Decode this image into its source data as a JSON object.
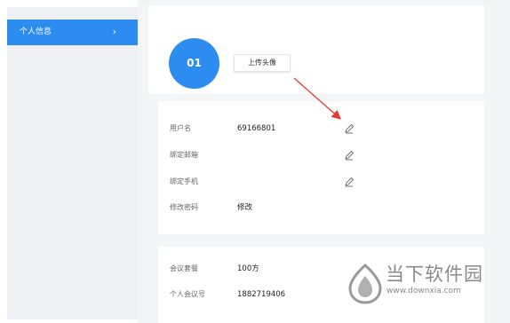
{
  "sidebar": {
    "items": [
      {
        "label": "个人信息"
      }
    ]
  },
  "profile": {
    "avatar_text": "01",
    "upload_label": "上传头像"
  },
  "account": {
    "rows": [
      {
        "label": "用户名",
        "value": "69166801",
        "editable": true
      },
      {
        "label": "绑定邮箱",
        "value": "",
        "editable": true
      },
      {
        "label": "绑定手机",
        "value": "",
        "editable": true
      },
      {
        "label": "修改密码",
        "value": "修改",
        "editable": false
      }
    ]
  },
  "meeting": {
    "rows": [
      {
        "label": "会议套餐",
        "value": "100方"
      },
      {
        "label": "个人会议号",
        "value": "1882719406"
      }
    ]
  },
  "watermark": {
    "title": "当下软件园",
    "url": "www.downxia.com"
  },
  "colors": {
    "accent": "#2d8cf0",
    "annotation_arrow": "#e53935",
    "sidebar_bg": "#eef0f4"
  }
}
